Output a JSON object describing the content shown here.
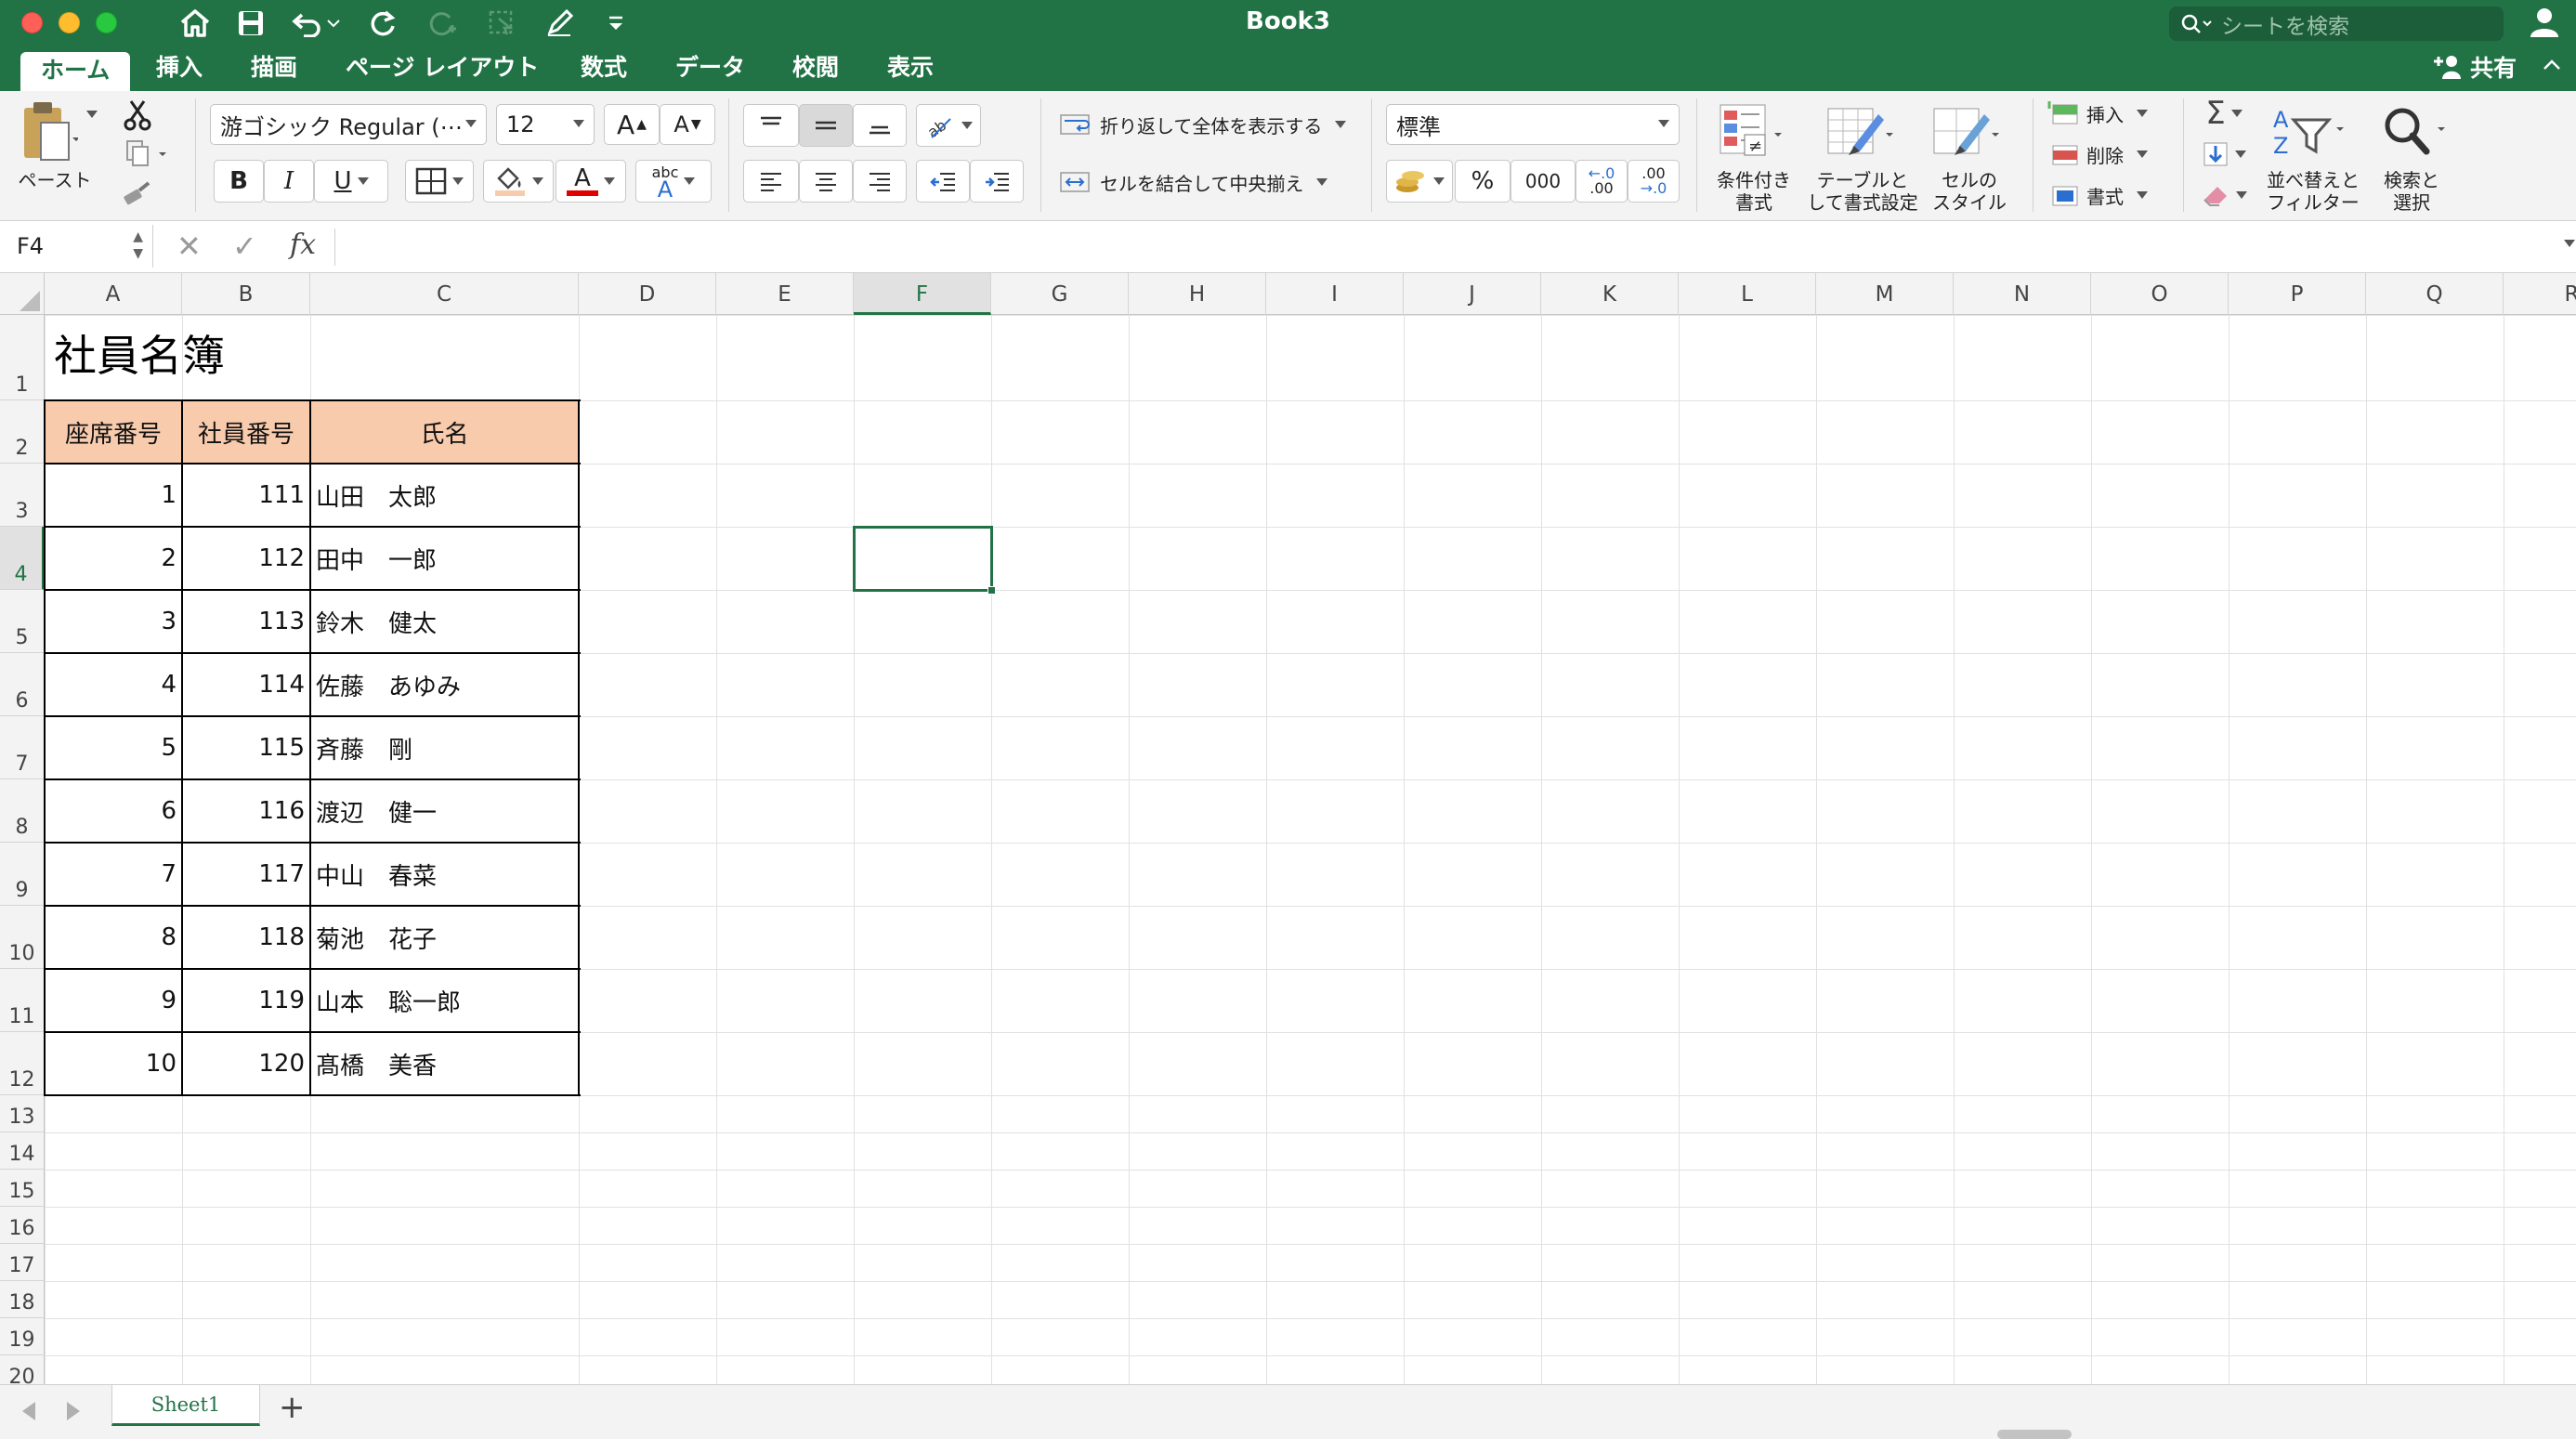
{
  "window": {
    "title": "Book3",
    "search_placeholder": "シートを検索"
  },
  "tabs": [
    {
      "label": "ホーム",
      "active": true
    },
    {
      "label": "挿入"
    },
    {
      "label": "描画"
    },
    {
      "label": "ページ レイアウト"
    },
    {
      "label": "数式"
    },
    {
      "label": "データ"
    },
    {
      "label": "校閲"
    },
    {
      "label": "表示"
    }
  ],
  "share_label": "共有",
  "ribbon": {
    "paste_label": "ペースト",
    "font_name": "游ゴシック Regular (⋯",
    "font_size": "12",
    "wrap_text_label": "折り返して全体を表示する",
    "merge_center_label": "セルを結合して中央揃え",
    "number_format": "標準",
    "conditional_format_label1": "条件付き",
    "conditional_format_label2": "書式",
    "table_format_label1": "テーブルと",
    "table_format_label2": "して書式設定",
    "cell_style_label1": "セルの",
    "cell_style_label2": "スタイル",
    "insert_label": "挿入",
    "delete_label": "削除",
    "format_label": "書式",
    "sort_filter_label1": "並べ替えと",
    "sort_filter_label2": "フィルター",
    "find_select_label1": "検索と",
    "find_select_label2": "選択",
    "bold": "B",
    "italic": "I",
    "underline": "U",
    "percent": "%",
    "thousands": "000",
    "font_grow": "A",
    "font_shrink": "A",
    "phonetic_small": "abc",
    "phonetic_big": "A",
    "font_color_glyph": "A",
    "dec_inc_top": "←.0",
    "dec_inc_bottom": ".00",
    "dec_dec_top": ".00",
    "dec_dec_bottom": "→.0",
    "sort_az_a": "A",
    "sort_az_z": "Z"
  },
  "formula_bar": {
    "name_box": "F4",
    "fx": "fx",
    "formula": ""
  },
  "grid": {
    "columns": [
      "A",
      "B",
      "C",
      "D",
      "E",
      "F",
      "G",
      "H",
      "I",
      "J",
      "K",
      "L",
      "M",
      "N",
      "O",
      "P",
      "Q",
      "R"
    ],
    "rows": [
      "1",
      "2",
      "3",
      "4",
      "5",
      "6",
      "7",
      "8",
      "9",
      "10",
      "11",
      "12",
      "13",
      "14",
      "15",
      "16",
      "17",
      "18",
      "19",
      "20"
    ],
    "selected_column": "F",
    "selected_row": "4",
    "title": "社員名簿",
    "table_headers": [
      "座席番号",
      "社員番号",
      "氏名"
    ],
    "header_fill": "#f8cbad",
    "table_rows": [
      {
        "seat": "1",
        "emp": "111",
        "name": "山田　太郎"
      },
      {
        "seat": "2",
        "emp": "112",
        "name": "田中　一郎"
      },
      {
        "seat": "3",
        "emp": "113",
        "name": "鈴木　健太"
      },
      {
        "seat": "4",
        "emp": "114",
        "name": "佐藤　あゆみ"
      },
      {
        "seat": "5",
        "emp": "115",
        "name": "斉藤　剛"
      },
      {
        "seat": "6",
        "emp": "116",
        "name": "渡辺　健一"
      },
      {
        "seat": "7",
        "emp": "117",
        "name": "中山　春菜"
      },
      {
        "seat": "8",
        "emp": "118",
        "name": "菊池　花子"
      },
      {
        "seat": "9",
        "emp": "119",
        "name": "山本　聡一郎"
      },
      {
        "seat": "10",
        "emp": "120",
        "name": "髙橋　美香"
      }
    ]
  },
  "sheets": [
    {
      "label": "Sheet1",
      "active": true
    }
  ],
  "colors": {
    "accent": "#217346",
    "header_fill": "#f8cbad"
  }
}
